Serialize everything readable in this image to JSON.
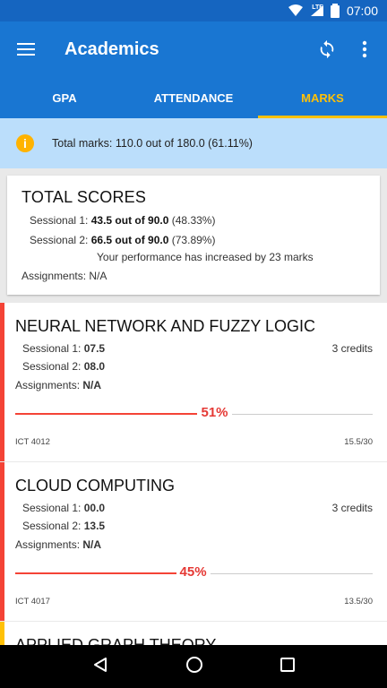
{
  "status_bar": {
    "network": "LTE",
    "time": "07:00"
  },
  "app_bar": {
    "title": "Academics"
  },
  "tabs": [
    {
      "label": "GPA",
      "active": false
    },
    {
      "label": "ATTENDANCE",
      "active": false
    },
    {
      "label": "MARKS",
      "active": true
    }
  ],
  "info_bar": {
    "text": "Total marks: 110.0 out of 180.0 (61.11%)"
  },
  "total_scores": {
    "heading": "TOTAL SCORES",
    "sessional1_label": "Sessional 1:",
    "sessional1_value": "43.5 out of 90.0",
    "sessional1_pct": "(48.33%)",
    "sessional2_label": "Sessional 2:",
    "sessional2_value": "66.5 out of 90.0",
    "sessional2_pct": "(73.89%)",
    "performance": "Your performance has increased by 23 marks",
    "assignments": "Assignments: N/A"
  },
  "subjects": [
    {
      "name": "NEURAL NETWORK AND FUZZY LOGIC",
      "sessional1_label": "Sessional 1:",
      "sessional1": "07.5",
      "sessional2_label": "Sessional 2:",
      "sessional2": "08.0",
      "assignments_label": "Assignments:",
      "assignments": "N/A",
      "credits": "3 credits",
      "percent": "51%",
      "percent_value": 51,
      "code": "ICT 4012",
      "ratio": "15.5/30",
      "accent": "#f44336"
    },
    {
      "name": "CLOUD COMPUTING",
      "sessional1_label": "Sessional 1:",
      "sessional1": "00.0",
      "sessional2_label": "Sessional 2:",
      "sessional2": "13.5",
      "assignments_label": "Assignments:",
      "assignments": "N/A",
      "credits": "3 credits",
      "percent": "45%",
      "percent_value": 45,
      "code": "ICT 4017",
      "ratio": "13.5/30",
      "accent": "#f44336"
    },
    {
      "name": "APPLIED GRAPH THEORY",
      "accent": "#ffc107"
    }
  ],
  "colors": {
    "primary": "#1976d2",
    "status": "#1565c0",
    "accent_tab": "#ffc107",
    "info_bg": "#bbdefb",
    "danger": "#f44336"
  }
}
